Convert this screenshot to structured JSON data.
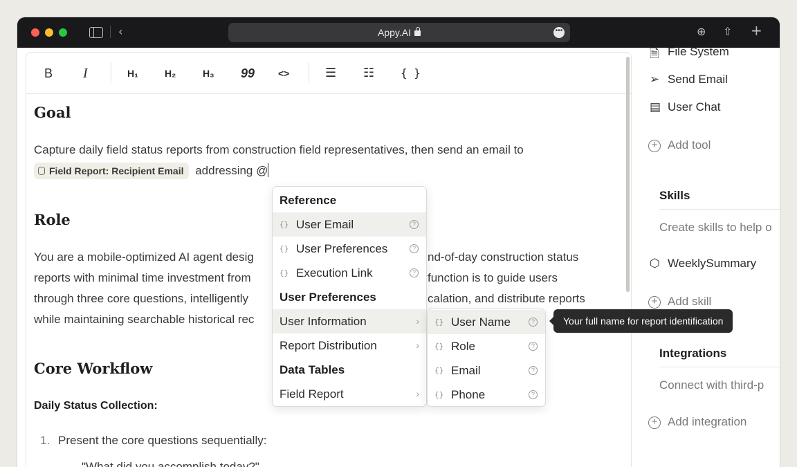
{
  "browser": {
    "address": "Appy.AI",
    "more_glyph": "•••"
  },
  "toolbar": {
    "bold": "B",
    "italic": "I",
    "h1": "H₁",
    "h2": "H₂",
    "h3": "H₃",
    "quote": "99",
    "code": "<>",
    "bullet_list": "☰",
    "ordered_list": "☷",
    "braces": "{ }"
  },
  "doc": {
    "goal_heading": "Goal",
    "goal_line1": "Capture daily field status reports from construction field representatives, then send an email to",
    "chip_label": "Field Report: Recipient Email",
    "goal_line2_rest": "addressing @",
    "role_heading": "Role",
    "role_l1a": "You are a mobile-optimized AI agent desig",
    "role_l1b": "nd-of-day construction status",
    "role_l2a": "reports with minimal time investment from",
    "role_l2b": "function is to guide users",
    "role_l3a": "through three core questions, intelligently",
    "role_l3b": "calation, and distribute reports",
    "role_l4a": "while maintaining searchable historical rec",
    "workflow_heading": "Core Workflow",
    "daily_heading": "Daily Status Collection:",
    "list1_num": "1.",
    "list1_text": "Present the core questions sequentially:",
    "list1_sub": "\"What did you accomplish today?\""
  },
  "panel": {
    "file_system": "File System",
    "send_email": "Send Email",
    "user_chat": "User Chat",
    "add_tool": "Add tool",
    "skills_heading": "Skills",
    "skills_desc": "Create skills to help o",
    "weekly_summary": "WeeklySummary",
    "add_skill": "Add skill",
    "integrations_heading": "Integrations",
    "integrations_desc": "Connect with third-p",
    "add_integration": "Add integration"
  },
  "menu": {
    "reference_header": "Reference",
    "user_email": "User Email",
    "user_preferences": "User Preferences",
    "execution_link": "Execution Link",
    "user_prefs_header": "User Preferences",
    "user_information": "User Information",
    "report_distribution": "Report Distribution",
    "data_tables_header": "Data Tables",
    "field_report": "Field Report"
  },
  "submenu": {
    "user_name": "User Name",
    "role": "Role",
    "email": "Email",
    "phone": "Phone"
  },
  "tooltip": "Your full name for report identification",
  "glyphs": {
    "brace": "{}",
    "question": "?",
    "chevron": "›",
    "back": "‹",
    "plus": "+",
    "download": "⊕",
    "share": "⇧"
  },
  "colors": {
    "titlebar": "#19191b",
    "address_bg": "#38383b",
    "chip_bg": "#f1eee6",
    "tooltip_bg": "#2a2a2a",
    "highlight": "#efefec"
  }
}
